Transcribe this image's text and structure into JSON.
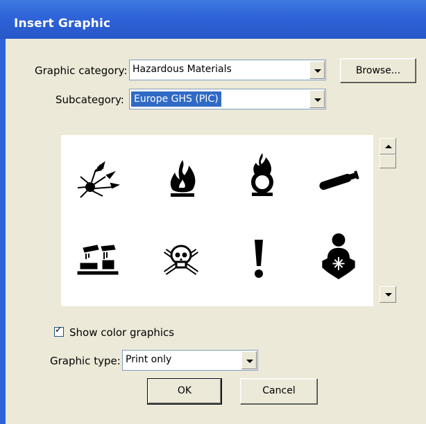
{
  "dialog": {
    "title": "Insert Graphic",
    "category_label": "Graphic category:",
    "category_value": "Hazardous Materials",
    "browse_label": "Browse...",
    "subcategory_label": "Subcategory:",
    "subcategory_value": "Europe GHS (PIC)",
    "show_color_label": "Show color graphics",
    "show_color_checked": true,
    "type_label": "Graphic type:",
    "type_value": "Print only",
    "ok_label": "OK",
    "cancel_label": "Cancel"
  },
  "graphics": [
    {
      "name": "explosive-icon"
    },
    {
      "name": "flammable-icon"
    },
    {
      "name": "oxidizer-icon"
    },
    {
      "name": "gas-cylinder-icon"
    },
    {
      "name": "corrosive-icon"
    },
    {
      "name": "skull-crossbones-icon"
    },
    {
      "name": "exclamation-icon"
    },
    {
      "name": "health-hazard-icon"
    }
  ],
  "colors": {
    "title_bar": "#2f63d8",
    "dialog_bg": "#ece9d8",
    "selection": "#316ac5"
  }
}
